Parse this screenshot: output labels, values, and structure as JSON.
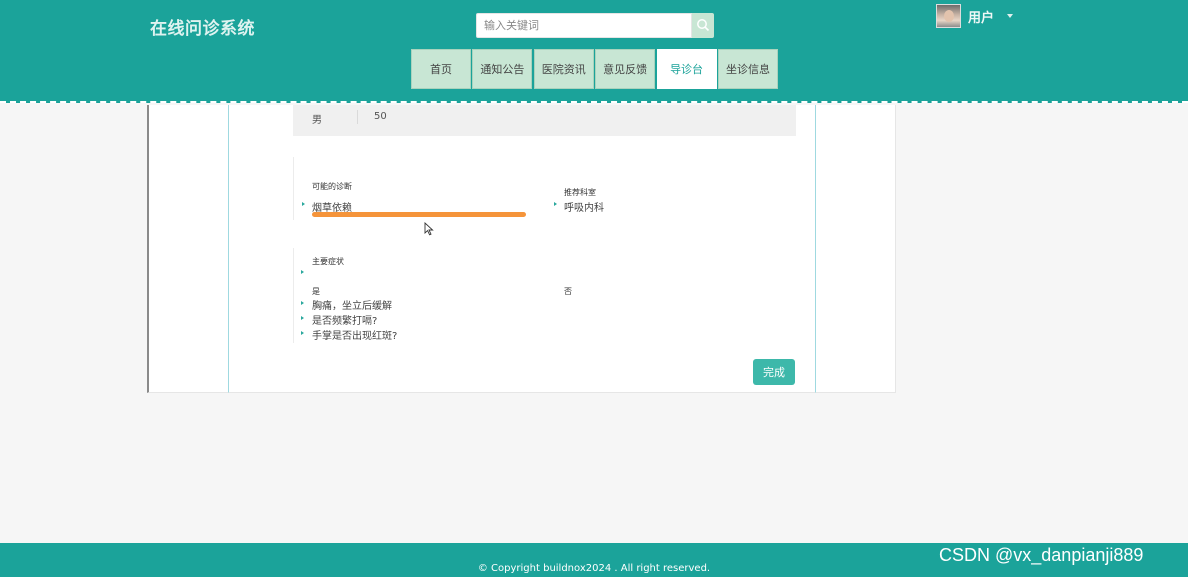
{
  "header": {
    "site_title": "在线问诊系统",
    "search": {
      "placeholder": "输入关键词",
      "icon": "search-icon"
    },
    "user": {
      "name": "用户",
      "icon": "chevron-down-icon"
    },
    "nav": [
      {
        "label": "首页",
        "active": false
      },
      {
        "label": "通知公告",
        "active": false
      },
      {
        "label": "医院资讯",
        "active": false
      },
      {
        "label": "意见反馈",
        "active": false
      },
      {
        "label": "导诊台",
        "active": true
      },
      {
        "label": "坐诊信息",
        "active": false
      }
    ]
  },
  "patient": {
    "gender": "男",
    "age": "50"
  },
  "diagnosis": {
    "possible_label": "可能的诊断",
    "possible_items": [
      "烟草依赖"
    ],
    "department_label": "推荐科室",
    "department_items": [
      "呼吸内科"
    ]
  },
  "symptoms": {
    "label": "主要症状",
    "yes_label": "是",
    "no_label": "否",
    "items": [
      "胸痛，坐立后缓解",
      "是否频繁打嗝?",
      "手掌是否出现红斑?"
    ]
  },
  "actions": {
    "done_label": "完成"
  },
  "footer": {
    "copyright": "© Copyright buildnox2024 . All right reserved.",
    "watermark": "CSDN @vx_danpianji889"
  },
  "colors": {
    "primary": "#1ba39a",
    "nav_bg": "#c8e6d4",
    "accent_bar": "#f5943a",
    "button": "#3db8aa"
  }
}
